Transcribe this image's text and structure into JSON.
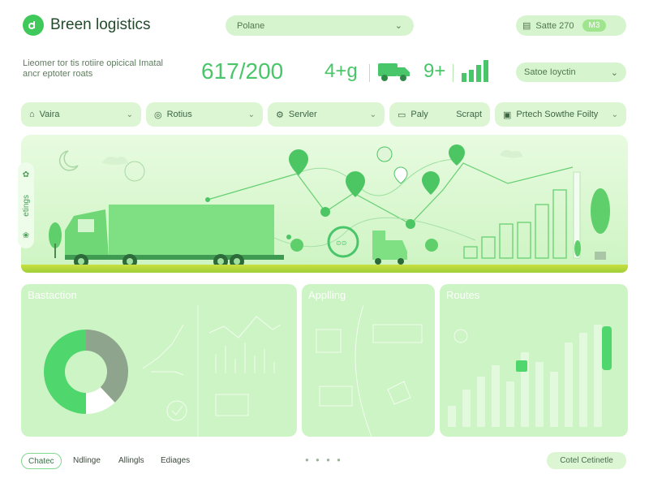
{
  "app": {
    "name": "Breen logistics"
  },
  "header": {
    "search_value": "Polane",
    "user_name": "Satte 270",
    "user_tag": "M3",
    "subtitle_line1": "Lieomer tor tis rotiire opicical Imatal",
    "subtitle_line2": "ancr eptoter roats"
  },
  "stats": {
    "main": "617/200",
    "second": "4+g",
    "third": "9+"
  },
  "select_right": {
    "label": "Satoe Ioyctin"
  },
  "filters": [
    {
      "label": "Vaira",
      "icon": "home-icon"
    },
    {
      "label": "Rotius",
      "icon": "route-icon"
    },
    {
      "label": "Servler",
      "icon": "service-icon"
    },
    {
      "label": "Paly",
      "icon": "document-icon",
      "extra": "Scrapt"
    },
    {
      "label": "Prtech Sowthe Foilty",
      "icon": "truck-icon"
    }
  ],
  "side_rail": {
    "label": "etings"
  },
  "panels": [
    {
      "title": "Bastaction"
    },
    {
      "title": "Applling"
    },
    {
      "title": "Routes"
    }
  ],
  "donut": {
    "segments": [
      0.38,
      0.12,
      0.5
    ],
    "colors": [
      "#8fa48c",
      "#ffffff",
      "#4fd66d"
    ]
  },
  "footer": {
    "button": "Chatec",
    "links": [
      "Ndlinge",
      "Allingls",
      "Ediages"
    ],
    "right_button": "Cotel Cetinetle"
  },
  "colors": {
    "accent": "#49c66a",
    "panel": "#cdf4c4",
    "pill": "#d6f5cf"
  }
}
